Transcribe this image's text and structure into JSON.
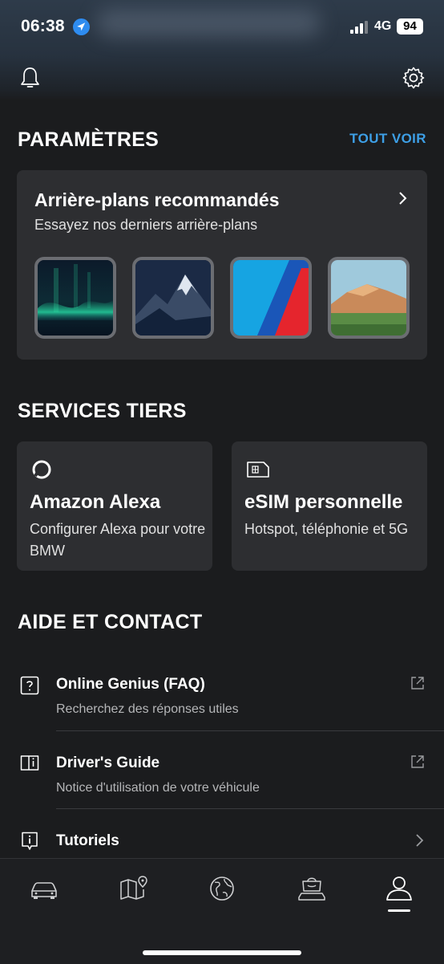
{
  "status_bar": {
    "time": "06:38",
    "network": "4G",
    "battery": "94"
  },
  "header": {
    "bell_icon": "bell-icon",
    "settings_icon": "gear-icon"
  },
  "settings_section": {
    "title": "PARAMÈTRES",
    "see_all": "TOUT VOIR",
    "card": {
      "title": "Arrière-plans recommandés",
      "subtitle": "Essayez nos derniers arrière-plans",
      "wallpapers": [
        "aurora",
        "night-mountain",
        "m-stripes",
        "sunset-mountain"
      ]
    }
  },
  "services_section": {
    "title": "SERVICES TIERS",
    "cards": [
      {
        "icon": "alexa-icon",
        "title": "Amazon Alexa",
        "subtitle": "Configurer Alexa pour votre BMW"
      },
      {
        "icon": "sim-card-icon",
        "title": "eSIM personnelle",
        "subtitle": "Hotspot, téléphonie et 5G"
      }
    ]
  },
  "help_section": {
    "title": "AIDE ET CONTACT",
    "items": [
      {
        "icon": "question-icon",
        "title": "Online Genius (FAQ)",
        "subtitle": "Recherchez des réponses utiles",
        "action": "external-link-icon"
      },
      {
        "icon": "book-icon",
        "title": "Driver's Guide",
        "subtitle": "Notice d'utilisation de votre véhicule",
        "action": "external-link-icon"
      },
      {
        "icon": "info-icon",
        "title": "Tutoriels",
        "subtitle": "",
        "action": "chevron-right-icon"
      }
    ]
  },
  "bottom_nav": {
    "items": [
      "car-icon",
      "map-icon",
      "globe-icon",
      "shop-icon",
      "profile-icon"
    ],
    "active": "profile-icon"
  },
  "colors": {
    "accent": "#3d9fe6",
    "background": "#1b1c1e",
    "card": "#2d2e31"
  }
}
